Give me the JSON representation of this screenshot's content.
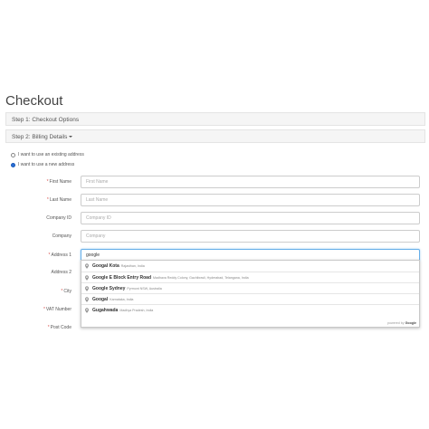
{
  "page": {
    "title": "Checkout"
  },
  "steps": {
    "step1": "Step 1: Checkout Options",
    "step2": "Step 2: Billing Details"
  },
  "address_choice": {
    "existing": "I want to use an existing address",
    "new": "I want to use a new address"
  },
  "form": {
    "first_name": {
      "label": "First Name",
      "placeholder": "First Name",
      "required": true
    },
    "last_name": {
      "label": "Last Name",
      "placeholder": "Last Name",
      "required": true
    },
    "company_id": {
      "label": "Company ID",
      "placeholder": "Company ID",
      "required": false
    },
    "company": {
      "label": "Company",
      "placeholder": "Company",
      "required": false
    },
    "address_1": {
      "label": "Address 1",
      "value": "google",
      "required": true
    },
    "address_2": {
      "label": "Address 2",
      "required": false
    },
    "city": {
      "label": "City",
      "required": true
    },
    "vat_number": {
      "label": "VAT Number",
      "required": true
    },
    "post_code": {
      "label": "Post Code",
      "required": true
    }
  },
  "autocomplete": {
    "items": [
      {
        "main": "Googal Kota",
        "secondary": "Rajasthan, India"
      },
      {
        "main": "Google E Block Entry Road",
        "secondary": "Madhava Reddy Colony, Gachibowli, Hyderabad, Telangana, India"
      },
      {
        "main": "Google Sydney",
        "secondary": "Pyrmont NSW, Australia"
      },
      {
        "main": "Googal",
        "secondary": "Karnataka, India"
      },
      {
        "main": "Gugahwada",
        "secondary": "Madhya Pradesh, India"
      }
    ],
    "powered_by": "powered by",
    "brand": "Google"
  },
  "colors": {
    "focus": "#66afe9",
    "required": "#d9534f",
    "radio_checked": "#2a6fd6"
  }
}
